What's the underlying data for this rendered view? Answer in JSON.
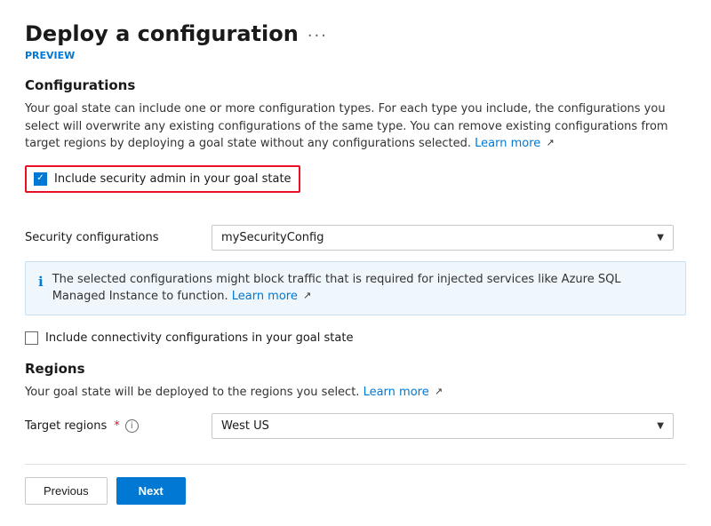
{
  "header": {
    "title": "Deploy a configuration",
    "ellipsis": "···",
    "preview": "PREVIEW"
  },
  "configurations": {
    "section_title": "Configurations",
    "description": "Your goal state can include one or more configuration types. For each type you include, the configurations you select will overwrite any existing configurations of the same type. You can remove existing configurations from target regions by deploying a goal state without any configurations selected.",
    "learn_more_link": "Learn more",
    "security_checkbox": {
      "label": "Include security admin in your goal state",
      "checked": true
    },
    "security_config_label": "Security configurations",
    "security_config_value": "mySecurityConfig",
    "info_box_text": "The selected configurations might block traffic that is required for injected services like Azure SQL Managed Instance to function.",
    "info_box_learn_more": "Learn more",
    "connectivity_checkbox": {
      "label": "Include connectivity configurations in your goal state",
      "checked": false
    }
  },
  "regions": {
    "section_title": "Regions",
    "description": "Your goal state will be deployed to the regions you select.",
    "learn_more_link": "Learn more",
    "target_regions_label": "Target regions",
    "required": true,
    "target_regions_value": "West US"
  },
  "footer": {
    "previous_label": "Previous",
    "next_label": "Next"
  }
}
